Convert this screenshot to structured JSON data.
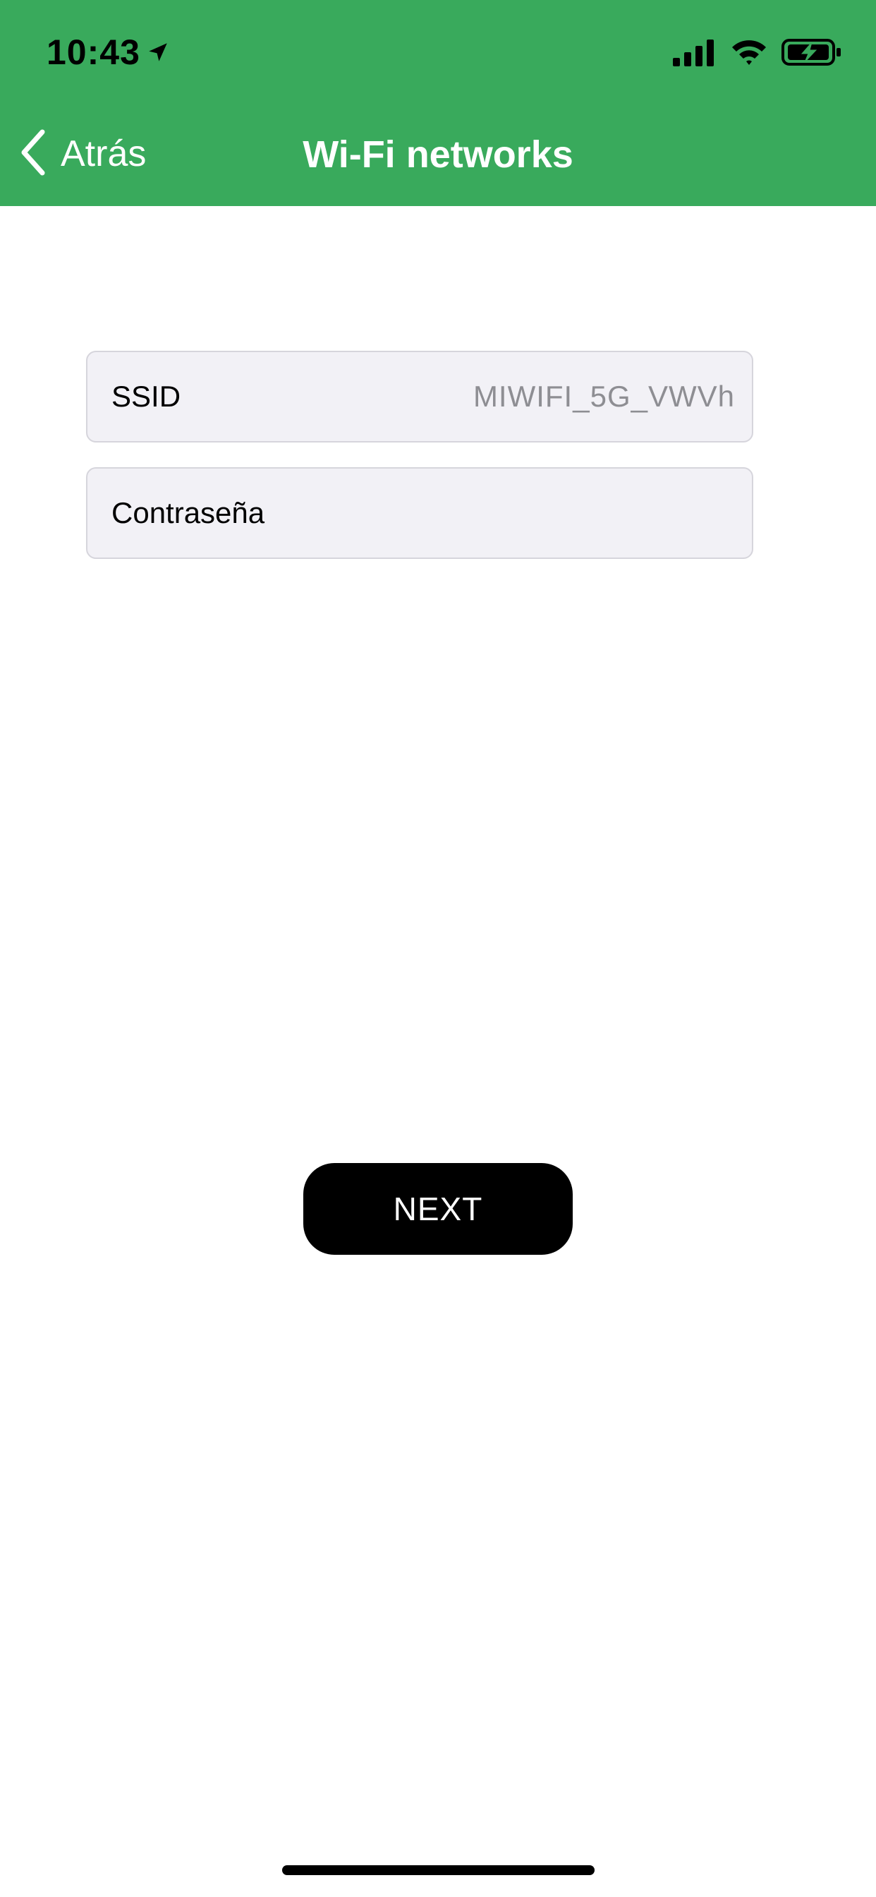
{
  "status_bar": {
    "time": "10:43",
    "icons": [
      "location-arrow-icon",
      "cellular-signal-icon",
      "wifi-icon",
      "battery-charging-icon"
    ]
  },
  "nav": {
    "back_label": "Atrás",
    "title": "Wi-Fi networks"
  },
  "form": {
    "ssid_label": "SSID",
    "ssid_value": "MIWIFI_5G_VWVh",
    "password_label": "Contraseña"
  },
  "actions": {
    "next_label": "NEXT"
  },
  "colors": {
    "header_bg": "#39aa5c",
    "field_bg": "#f2f1f6",
    "button_bg": "#000000"
  }
}
